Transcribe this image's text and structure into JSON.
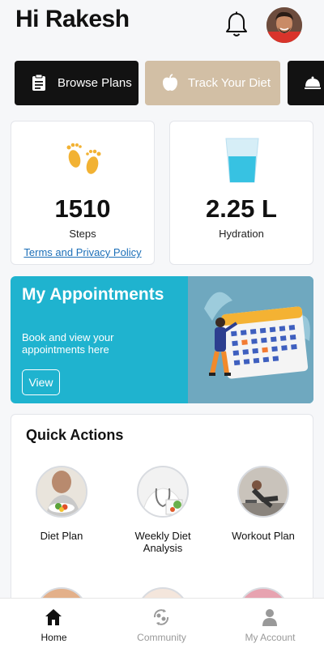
{
  "header": {
    "greeting": "Hi Rakesh",
    "notification_icon": "bell-icon",
    "avatar_icon": "user-avatar"
  },
  "quick_chips": [
    {
      "label": "Browse Plans",
      "icon": "clipboard-icon",
      "color": "#121212"
    },
    {
      "label": "Track Your Diet",
      "icon": "apple-icon",
      "color": "#d2bfa5"
    },
    {
      "label": "",
      "icon": "cloche-icon",
      "color": "#121212"
    }
  ],
  "stats": {
    "steps": {
      "value": "1510",
      "label": "Steps",
      "icon": "footprints-icon"
    },
    "terms_link": "Terms and Privacy Policy",
    "hydration": {
      "value": "2.25 L",
      "label": "Hydration",
      "icon": "water-glass-icon"
    }
  },
  "appointments": {
    "title": "My Appointments",
    "subtitle": "Book and view your appointments here",
    "button": "View",
    "color": "#1fb3cf"
  },
  "quick_actions": {
    "title": "Quick Actions",
    "items": [
      {
        "label": "Diet Plan"
      },
      {
        "label": "Weekly Diet Analysis"
      },
      {
        "label": "Workout Plan"
      }
    ]
  },
  "bottom_nav": {
    "items": [
      {
        "label": "Home",
        "icon": "home-icon",
        "active": true
      },
      {
        "label": "Community",
        "icon": "community-icon",
        "active": false
      },
      {
        "label": "My Account",
        "icon": "account-icon",
        "active": false
      }
    ]
  }
}
